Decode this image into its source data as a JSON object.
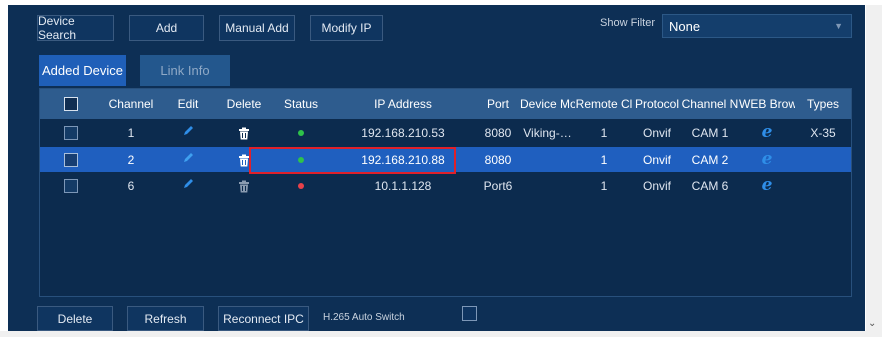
{
  "toolbar": {
    "device_search": "Device Search",
    "add": "Add",
    "manual_add": "Manual Add",
    "modify_ip": "Modify IP"
  },
  "filter": {
    "label": "Show Filter",
    "value": "None"
  },
  "tabs": {
    "added_device": "Added Device",
    "link_info": "Link Info"
  },
  "table": {
    "headers": [
      "Channel",
      "Edit",
      "Delete",
      "Status",
      "IP Address",
      "Port",
      "Device Mo",
      "Remote Cl",
      "Protocol",
      "Channel N",
      "WEB Brow",
      "Types"
    ],
    "rows": [
      {
        "channel": "1",
        "ip": "192.168.210.53",
        "port": "8080",
        "device_model": "Viking-…",
        "remote_ch": "1",
        "protocol": "Onvif",
        "channel_name": "CAM 1",
        "type": "X-35",
        "status": "online"
      },
      {
        "channel": "2",
        "ip": "192.168.210.88",
        "port": "8080",
        "device_model": "",
        "remote_ch": "1",
        "protocol": "Onvif",
        "channel_name": "CAM 2",
        "type": "",
        "status": "online"
      },
      {
        "channel": "6",
        "ip": "10.1.1.128",
        "port": "Port6",
        "device_model": "",
        "remote_ch": "1",
        "protocol": "Onvif",
        "channel_name": "CAM 6",
        "type": "",
        "status": "offline"
      }
    ]
  },
  "bottom": {
    "delete": "Delete",
    "refresh": "Refresh",
    "reconnect": "Reconnect IPC",
    "h265_label": "H.265 Auto Switch"
  },
  "colors": {
    "panel": "#0d2f55",
    "accent": "#1f5fbf",
    "status_online": "#2ec24a",
    "status_offline": "#e8414a",
    "highlight_box": "#e0202a"
  },
  "icons": {
    "edit": "pencil-icon",
    "delete": "trash-icon",
    "status": "status-dot-icon",
    "web": "internet-explorer-icon",
    "dropdown": "chevron-down-icon"
  }
}
